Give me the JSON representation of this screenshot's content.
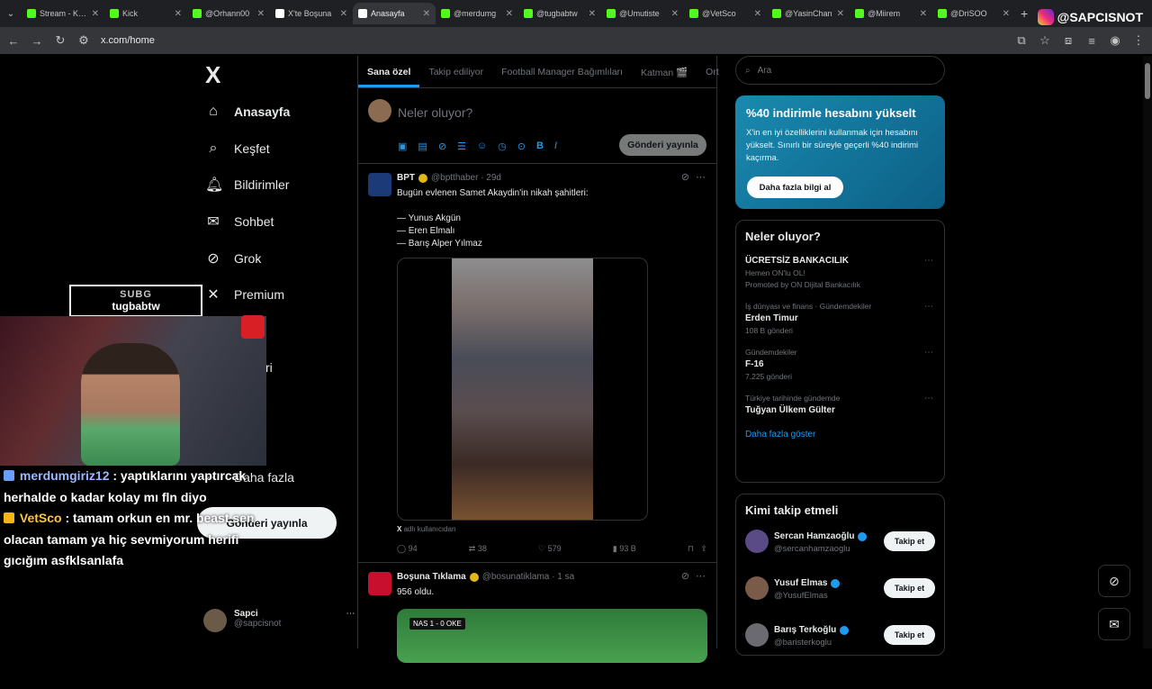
{
  "browser": {
    "tabs": [
      {
        "title": "Stream - Kick",
        "favicon_color": "#53fc18",
        "active": false
      },
      {
        "title": "Kick",
        "favicon_color": "#53fc18",
        "active": false
      },
      {
        "title": "@Orhann00",
        "favicon_color": "#53fc18",
        "active": false
      },
      {
        "title": "X'te Boşuna",
        "favicon_color": "#ffffff",
        "active": false
      },
      {
        "title": "Anasayfa",
        "favicon_color": "#ffffff",
        "active": true
      },
      {
        "title": "@merdumg",
        "favicon_color": "#53fc18",
        "active": false
      },
      {
        "title": "@tugbabtw",
        "favicon_color": "#53fc18",
        "active": false
      },
      {
        "title": "@Umutiste",
        "favicon_color": "#53fc18",
        "active": false
      },
      {
        "title": "@VetSco",
        "favicon_color": "#53fc18",
        "active": false
      },
      {
        "title": "@YasinChan",
        "favicon_color": "#53fc18",
        "active": false
      },
      {
        "title": "@Miirem",
        "favicon_color": "#53fc18",
        "active": false
      },
      {
        "title": "@DriSOO",
        "favicon_color": "#53fc18",
        "active": false
      }
    ],
    "url": "x.com/home",
    "watermark": "@SAPCISNOT"
  },
  "nav": {
    "logo": "X",
    "items": [
      {
        "label": "Anasayfa",
        "icon": "home-icon",
        "glyph": "⌂"
      },
      {
        "label": "Keşfet",
        "icon": "search-icon",
        "glyph": "⌕"
      },
      {
        "label": "Bildirimler",
        "icon": "bell-icon",
        "glyph": "🔔︎"
      },
      {
        "label": "Sohbet",
        "icon": "mail-icon",
        "glyph": "✉"
      },
      {
        "label": "Grok",
        "icon": "grok-icon",
        "glyph": "⊘"
      },
      {
        "label": "Premium",
        "icon": "x-icon",
        "glyph": "✕"
      },
      {
        "label": "",
        "icon": "list-icon",
        "glyph": ""
      },
      {
        "label": "aretleri",
        "icon": "bookmark-icon",
        "glyph": ""
      },
      {
        "label": "uklar",
        "icon": "communities-icon",
        "glyph": ""
      },
      {
        "label": "",
        "icon": "profile-icon",
        "glyph": ""
      },
      {
        "label": "Daha fazla",
        "icon": "more-icon",
        "glyph": "⋯"
      }
    ],
    "post_button": "Gönderi yayınla",
    "account_name": "Sapci",
    "account_handle": "@sapcisnot"
  },
  "main": {
    "tabs": [
      "Sana özel",
      "Takip ediliyor",
      "Football Manager Bağımlıları",
      "Katman 🎬",
      "Ort"
    ],
    "compose_placeholder": "Neler oluyor?",
    "compose_button": "Gönderi yayınla",
    "tweets": [
      {
        "name": "BPT",
        "handle": "@bptthaber · 29d",
        "avatar_color": "#1c3a78",
        "text_lines": [
          "Bugün evlenen Samet Akaydin'in nikah şahitleri:",
          "",
          "— Yunus Akgün",
          "— Eren Elmalı",
          "— Barış Alper Yılmaz"
        ],
        "caption_x": "X",
        "caption": "adlı kullanıcıdan",
        "replies": "94",
        "retweets": "38",
        "likes": "579",
        "views": "93 B"
      },
      {
        "name": "Boşuna Tıklama",
        "handle": "@bosunatiklama · 1 sa",
        "avatar_color": "#c8102e",
        "text_lines": [
          "956 oldu."
        ],
        "score": "NAS 1 - 0 OKE"
      }
    ]
  },
  "right": {
    "search_placeholder": "Ara",
    "premium": {
      "title": "%40 indirimle hesabını yükselt",
      "text": "X'in en iyi özelliklerini kullanmak için hesabını yükselt. Sınırlı bir süreyle geçerli %40 indirimi kaçırma.",
      "cta": "Daha fazla bilgi al"
    },
    "trends_title": "Neler oluyor?",
    "trends": [
      {
        "context": "",
        "title": "ÜCRETSİZ BANKACILIK",
        "sub": "Hemen ON'lu OL!",
        "extra": "Promoted by ON Dijital Bankacılık"
      },
      {
        "context": "İş dünyası ve finans · Gündemdekiler",
        "title": "Erden Timur",
        "sub": "108 B gönderi",
        "extra": ""
      },
      {
        "context": "Gündemdekiler",
        "title": "F-16",
        "sub": "7.225 gönderi",
        "extra": ""
      },
      {
        "context": "Türkiye tarihinde gündemde",
        "title": "Tuğyan Ülkem Gülter",
        "sub": "",
        "extra": ""
      }
    ],
    "show_more": "Daha fazla göster",
    "who_title": "Kimi takip etmeli",
    "who": [
      {
        "name": "Sercan Hamzaoğlu",
        "handle": "@sercanhamzaoglu",
        "avatar_color": "#5a4a86"
      },
      {
        "name": "Yusuf Elmas",
        "handle": "@YusufElmas",
        "avatar_color": "#7a5a48"
      },
      {
        "name": "Barış Terkoğlu",
        "handle": "@baristerkoglu",
        "avatar_color": "#6a6a70"
      }
    ],
    "follow_label": "Takip et"
  },
  "overlay": {
    "sub_badge_top": "SUBG",
    "sub_badge_name": "tugbabtw",
    "chat": [
      {
        "user": "merdumgiriz12",
        "text": ": yaptıklarını yaptırcak herhalde o kadar kolay mı fln diyo"
      },
      {
        "user": "VetSco",
        "text": ": tamam orkun en mr. beast sen olacan tamam ya hiç sevmiyorum herifi gıcığım asfklsanlafa"
      }
    ]
  },
  "colors": {
    "accent": "#1d9bf0",
    "background": "#000000",
    "border": "#2f3336"
  }
}
